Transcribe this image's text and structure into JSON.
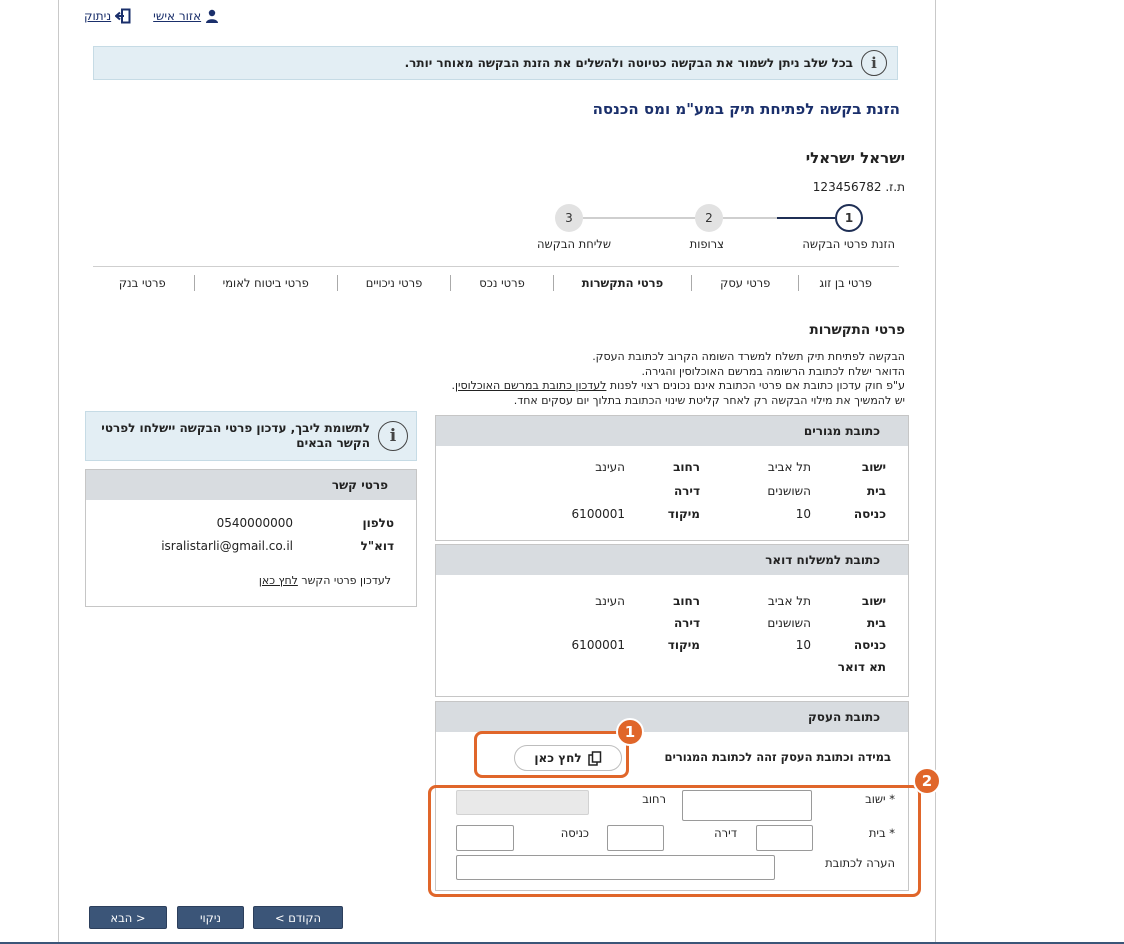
{
  "topnav": {
    "logout": "ניתוק",
    "personal_area": "אזור אישי"
  },
  "banner": {
    "text": "בכל שלב ניתן לשמור את הבקשה כטיוטה ולהשלים את הזנת הבקשה מאוחר יותר."
  },
  "page_title": "הזנת בקשה לפתיחת תיק במע\"מ ומס הכנסה",
  "user": {
    "name": "ישראל ישראלי",
    "id_label": "ת.ז. 123456782"
  },
  "steps": [
    {
      "num": "1",
      "label": "הזנת פרטי הבקשה"
    },
    {
      "num": "2",
      "label": "צרופות"
    },
    {
      "num": "3",
      "label": "שליחת הבקשה"
    }
  ],
  "tabs": [
    "פרטי בן זוג",
    "פרטי עסק",
    "פרטי התקשרות",
    "פרטי נכס",
    "פרטי ניכויים",
    "פרטי ביטוח לאומי",
    "פרטי בנק"
  ],
  "section_title": "פרטי התקשרות",
  "intro": {
    "line1": "הבקשה לפתיחת תיק תשלח למשרד השומה הקרוב לכתובת העסק.",
    "line2": "הדואר ישלח לכתובת הרשומה במרשם האוכלוסין והגירה.",
    "line3_pre": "ע\"פ חוק עדכון כתובת אם פרטי הכתובת אינם נכונים רצוי לפנות ",
    "line3_link": "לעדכון כתובת במרשם האוכלוסין",
    "line3_post": ".",
    "line4": "יש להמשיך את מילוי הבקשה רק לאחר קליטת שינוי הכתובת בתלוך יום עסקים אחד."
  },
  "residence": {
    "title": "כתובת מגורים",
    "labels": {
      "settlement": "ישוב",
      "house": "בית",
      "entrance": "כניסה",
      "street": "רחוב",
      "apartment": "דירה",
      "zip": "מיקוד"
    },
    "values": {
      "settlement": "תל אביב",
      "house": "השושנים",
      "entrance": "10",
      "street": "העינב",
      "zip": "6100001"
    }
  },
  "mailing": {
    "title": "כתובת למשלוח דואר",
    "labels": {
      "settlement": "ישוב",
      "house": "בית",
      "entrance": "כניסה",
      "street": "רחוב",
      "apartment": "דירה",
      "zip": "מיקוד",
      "pobox": "תא דואר"
    },
    "values": {
      "settlement": "תל אביב",
      "house": "השושנים",
      "entrance": "10",
      "street": "העינב",
      "zip": "6100001"
    }
  },
  "business": {
    "title": "כתובת העסק",
    "same_label": "במידה וכתובת העסק זהה לכתובת המגורים",
    "click_here": "לחץ כאן",
    "form": {
      "settlement": "* ישוב",
      "street": "רחוב",
      "house": "* בית",
      "apartment": "דירה",
      "entrance": "כניסה",
      "note": "הערה לכתובת"
    }
  },
  "side_info": {
    "text": "לתשומת ליבך, עדכון פרטי הבקשה יישלחו לפרטי הקשר הבאים"
  },
  "contact": {
    "title": "פרטי קשר",
    "phone_label": "טלפון",
    "phone": "0540000000",
    "email_label": "דוא\"ל",
    "email": "isralistarli@gmail.co.il",
    "update_text": "לעדכון פרטי הקשר ",
    "update_link": "לחץ כאן"
  },
  "callouts": {
    "one": "1",
    "two": "2"
  },
  "buttons": {
    "prev": "< הקודם",
    "clear": "ניקוי",
    "next": "הבא >"
  },
  "colors": {
    "accent": "#1a2f6b",
    "button": "#3b5578",
    "callout": "#e0662a",
    "info_bg": "#e3eef4",
    "panel_head": "#d8dce0"
  }
}
